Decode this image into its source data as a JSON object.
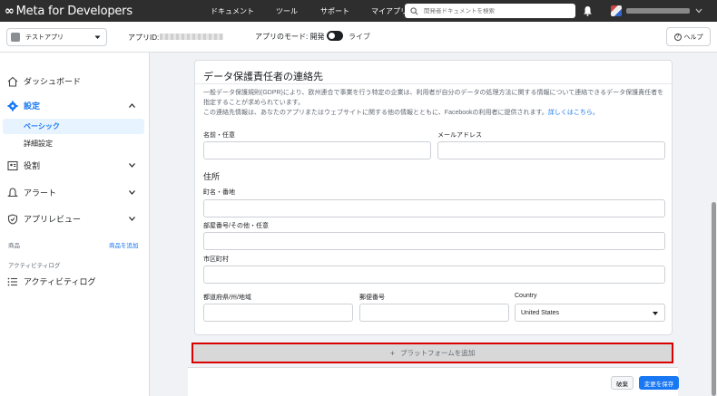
{
  "topbar": {
    "logo": "Meta for Developers",
    "nav": [
      "ドキュメント",
      "ツール",
      "サポート",
      "マイアプリ"
    ],
    "search_placeholder": "開発者ドキュメントを検索"
  },
  "subbar": {
    "app_name": "テストアプリ",
    "app_id_label": "アプリID:",
    "mode_label": "アプリのモード: 開発",
    "mode_live": "ライブ",
    "help": "ヘルプ"
  },
  "sidebar": {
    "dashboard": "ダッシュボード",
    "settings": "設定",
    "basic": "ベーシック",
    "advanced": "詳細設定",
    "roles": "役割",
    "alerts": "アラート",
    "app_review": "アプリレビュー",
    "products_section": "商品",
    "add_product": "商品を追加",
    "activity_section": "アクティビティログ",
    "activity_log": "アクティビティログ"
  },
  "card": {
    "title": "データ保護責任者の連絡先",
    "desc_line1": "一般データ保護規則(GDPR)により、欧州連合で事業を行う特定の企業は、利用者が自分のデータの処理方法に関する情報について連絡できるデータ保護責任者を指定することが求められています。",
    "desc_line2": "この連絡先情報は、あなたのアプリまたはウェブサイトに関する他の情報とともに、Facebookの利用者に提供されます。",
    "learn_more": "詳しくはこちら。",
    "name_label": "名前・任意",
    "email_label": "メールアドレス",
    "address_section": "住所",
    "street_label": "町名・番地",
    "apt_label": "部屋番号/その他・任意",
    "city_label": "市区町村",
    "state_label": "都道府県/州/地域",
    "zip_label": "郵便番号",
    "country_label": "Country",
    "country_value": "United States"
  },
  "add_platform": "プラットフォームを追加",
  "footer": {
    "discard": "破棄",
    "save": "変更を保存"
  }
}
